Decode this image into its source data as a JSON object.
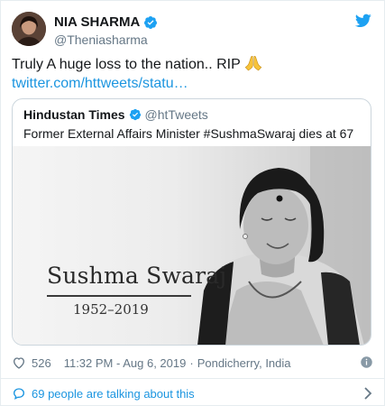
{
  "author": {
    "display_name": "NIA SHARMA",
    "handle": "@Theniasharma",
    "avatar_icon": "user-avatar"
  },
  "tweet": {
    "text": "Truly A huge loss to the nation.. RIP",
    "emoji_icon": "folded-hands-icon",
    "link": "twitter.com/httweets/statu…"
  },
  "quote": {
    "name": "Hindustan Times",
    "handle": "@htTweets",
    "text": "Former External Affairs Minister #SushmaSwaraj dies at 67",
    "image_title": "Sushma Swaraj",
    "image_years": "1952–2019"
  },
  "meta": {
    "likes": "526",
    "time": "11:32 PM - Aug 6, 2019",
    "separator": "·",
    "location": "Pondicherry, India"
  },
  "footer": {
    "talking": "69 people are talking about this"
  },
  "colors": {
    "link": "#1b95e0",
    "verified": "#1da1f2",
    "secondary_text": "#657786",
    "border": "#ccd6dd"
  }
}
